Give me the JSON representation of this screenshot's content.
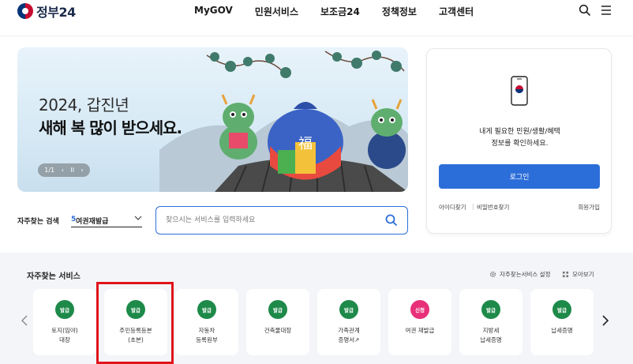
{
  "header": {
    "logo_text": "정부24",
    "nav": [
      "MyGOV",
      "민원서비스",
      "보조금24",
      "정책정보",
      "고객센터"
    ]
  },
  "banner": {
    "line1": "2024, 갑진년",
    "line2": "새해 복 많이 받으세요.",
    "counter": "1/1",
    "prev": "‹",
    "pause": "II",
    "next": "›"
  },
  "login": {
    "badge_text": "정부24",
    "message_line1": "내게 필요한 민원/생활/혜택",
    "message_line2": "정보를 확인하세요.",
    "button": "로그인",
    "link_id": "아이디찾기",
    "link_sep": "|",
    "link_pw": "비밀번호찾기",
    "link_join": "회원가입"
  },
  "search": {
    "freq_label": "자주찾는 검색",
    "freq_number": "5",
    "freq_value": "여권재발급",
    "placeholder": "찾으시는 서비스를 입력하세요"
  },
  "services": {
    "title": "자주찾는 서비스",
    "settings_label": "자주찾는서비스 설정",
    "view_all_label": "모아보기",
    "items": [
      {
        "badge": "발급",
        "name1": "토지(임야)",
        "name2": "대장"
      },
      {
        "badge": "발급",
        "name1": "주민등록등본",
        "name2": "(초본)"
      },
      {
        "badge": "발급",
        "name1": "자동차",
        "name2": "등록원부"
      },
      {
        "badge": "발급",
        "name1": "건축물대장",
        "name2": ""
      },
      {
        "badge": "발급",
        "name1": "가족관계",
        "name2": "증명서↗"
      },
      {
        "badge": "신청",
        "name1": "여권 재발급",
        "name2": ""
      },
      {
        "badge": "발급",
        "name1": "지방세",
        "name2": "납세증명"
      },
      {
        "badge": "발급",
        "name1": "납세증명",
        "name2": ""
      }
    ]
  },
  "colors": {
    "badge_issue": "#1e8a4a",
    "badge_apply": "#e8307a",
    "primary": "#2c6ed9",
    "highlight": "#e0141b"
  }
}
